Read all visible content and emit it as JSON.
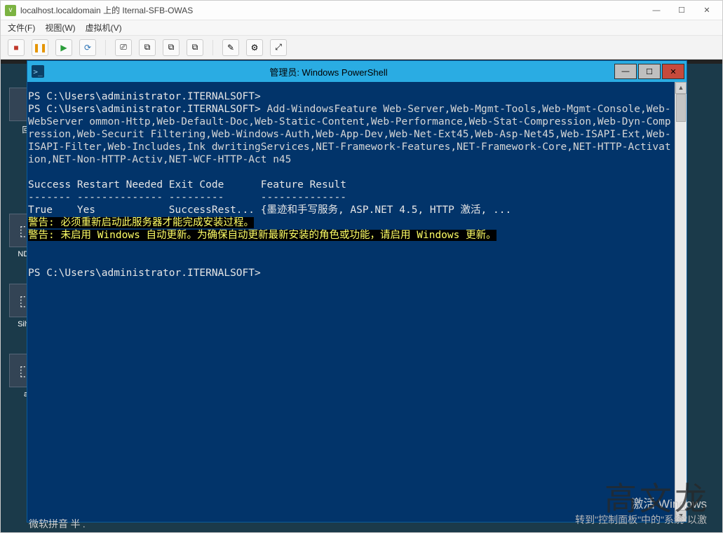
{
  "outer": {
    "title": "localhost.localdomain 上的 Iternal-SFB-OWAS",
    "menu": {
      "file": "文件(F)",
      "view": "视图(W)",
      "vm": "虚拟机(V)"
    },
    "winbtn": {
      "min": "—",
      "max": "☐",
      "close": "✕"
    }
  },
  "toolbar": {
    "stop": "■",
    "pause": "❚❚",
    "play": "▶",
    "restart": "⟳",
    "snap": "⎚",
    "a": "⧉",
    "b": "⧉",
    "c": "⧉",
    "d": "✎",
    "e": "⚙",
    "f": "⤢"
  },
  "desktop": {
    "icon1": "回",
    "icon2": "NDP",
    "icon3": "Silve",
    "icon4": "a"
  },
  "ps": {
    "title": "管理员: Windows PowerShell",
    "prompt": "PS C:\\Users\\administrator.ITERNALSOFT>",
    "cmd": "Add-WindowsFeature Web-Server,Web-Mgmt-Tools,Web-Mgmt-Console,Web-WebServer ommon-Http,Web-Default-Doc,Web-Static-Content,Web-Performance,Web-Stat-Compression,Web-Dyn-Compression,Web-Securit Filtering,Web-Windows-Auth,Web-App-Dev,Web-Net-Ext45,Web-Asp-Net45,Web-ISAPI-Ext,Web-ISAPI-Filter,Web-Includes,Ink dwritingServices,NET-Framework-Features,NET-Framework-Core,NET-HTTP-Activation,NET-Non-HTTP-Activ,NET-WCF-HTTP-Act n45",
    "hdr": "Success Restart Needed Exit Code      Feature Result",
    "sep": "------- -------------- ---------      --------------",
    "row": "True    Yes            SuccessRest... {墨迹和手写服务, ASP.NET 4.5, HTTP 激活, ...",
    "warn1": "警告: 必须重新启动此服务器才能完成安装过程。",
    "warn2": "警告: 未启用 Windows 自动更新。为确保自动更新最新安装的角色或功能，请启用 Windows 更新。",
    "ime": "微软拼音 半 ."
  },
  "watermark": {
    "line1": "激活 Windows",
    "line2": "转到\"控制面板\"中的\"系统\"以激"
  },
  "signature": "高文龙"
}
